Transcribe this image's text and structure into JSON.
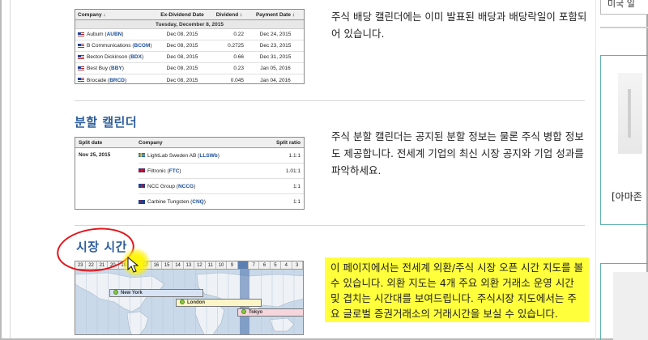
{
  "right_sidebar": {
    "top_label": "미국 일",
    "caption": "[아마존"
  },
  "dividend_table": {
    "headers": [
      "Company ↓",
      "Ex-Dividend Date",
      "Dividend ↕",
      "Payment Date ↕"
    ],
    "group_label": "Tuesday, December 8, 2015",
    "rows": [
      {
        "name": "Aubum",
        "ticker": "AUBN",
        "flag": "us",
        "ex_date": "Dec 08, 2015",
        "dividend": "0.22",
        "pay_date": "Dec 24, 2015"
      },
      {
        "name": "B Communications",
        "ticker": "BCOM",
        "flag": "us",
        "ex_date": "Dec 08, 2015",
        "dividend": "0.2725",
        "pay_date": "Dec 23, 2015"
      },
      {
        "name": "Becton Dickinson",
        "ticker": "BDX",
        "flag": "us",
        "ex_date": "Dec 08, 2015",
        "dividend": "0.66",
        "pay_date": "Dec 31, 2015"
      },
      {
        "name": "Best Buy",
        "ticker": "BBY",
        "flag": "us",
        "ex_date": "Dec 08, 2015",
        "dividend": "0.23",
        "pay_date": "Jan 05, 2016"
      },
      {
        "name": "Brocade",
        "ticker": "BRCD",
        "flag": "us",
        "ex_date": "Dec 08, 2015",
        "dividend": "0.045",
        "pay_date": "Jan 04, 2016"
      }
    ]
  },
  "dividend_desc": "주식 배당 캘린더에는 이미 발표된 배당과 배당락일이 포함되어 있습니다.",
  "split_section": {
    "title": "분할 캘린더",
    "headers": [
      "Split date",
      "Company",
      "Split ratio"
    ],
    "date": "Nov 25, 2015",
    "rows": [
      {
        "name": "LightLab Sweden AB",
        "ticker": "LLSWb",
        "flag": "se",
        "ratio": "1.1:1"
      },
      {
        "name": "Filtronic",
        "ticker": "FTC",
        "flag": "gb",
        "ratio": "1.01:1"
      },
      {
        "name": "NCC Group",
        "ticker": "NCCG",
        "flag": "gb",
        "ratio": "1:1"
      },
      {
        "name": "Carbine Tungsten",
        "ticker": "CNQ",
        "flag": "au",
        "ratio": "1:1"
      }
    ],
    "desc": "주식 분할 캘린더는 공지된 분할 정보는 물론 주식 병합 정보도 제공합니다. 전세계 기업의 최신 시장 공지와 기업 성과를 파악하세요."
  },
  "market_hours_section": {
    "title": "시장 시간",
    "hours": [
      "23",
      "22",
      "21",
      "20",
      "19",
      "18",
      "17",
      "16",
      "15",
      "14",
      "13",
      "12",
      "11",
      "10",
      "9",
      "8",
      "7",
      "6",
      "5",
      "4",
      "3"
    ],
    "markets": [
      {
        "name": "New York"
      },
      {
        "name": "London"
      },
      {
        "name": "Tokyo"
      }
    ],
    "desc": "이 페이지에서는 전세계 외환/주식 시장 오픈 시간 지도를 볼 수 있습니다. 외환 지도는 4개 주요 외환 거래소 운영 시간 및 겹치는 시간대를 보여드립니다. 주식시장 지도에서는 주요 글로벌 증권거래소의 거래시간을 보실 수 있습니다."
  },
  "colors": {
    "heading_blue": "#2f5f9c",
    "highlight_yellow": "#ffff3c",
    "annotation_red": "#e2151b",
    "ticker_blue": "#1a4f9c"
  }
}
